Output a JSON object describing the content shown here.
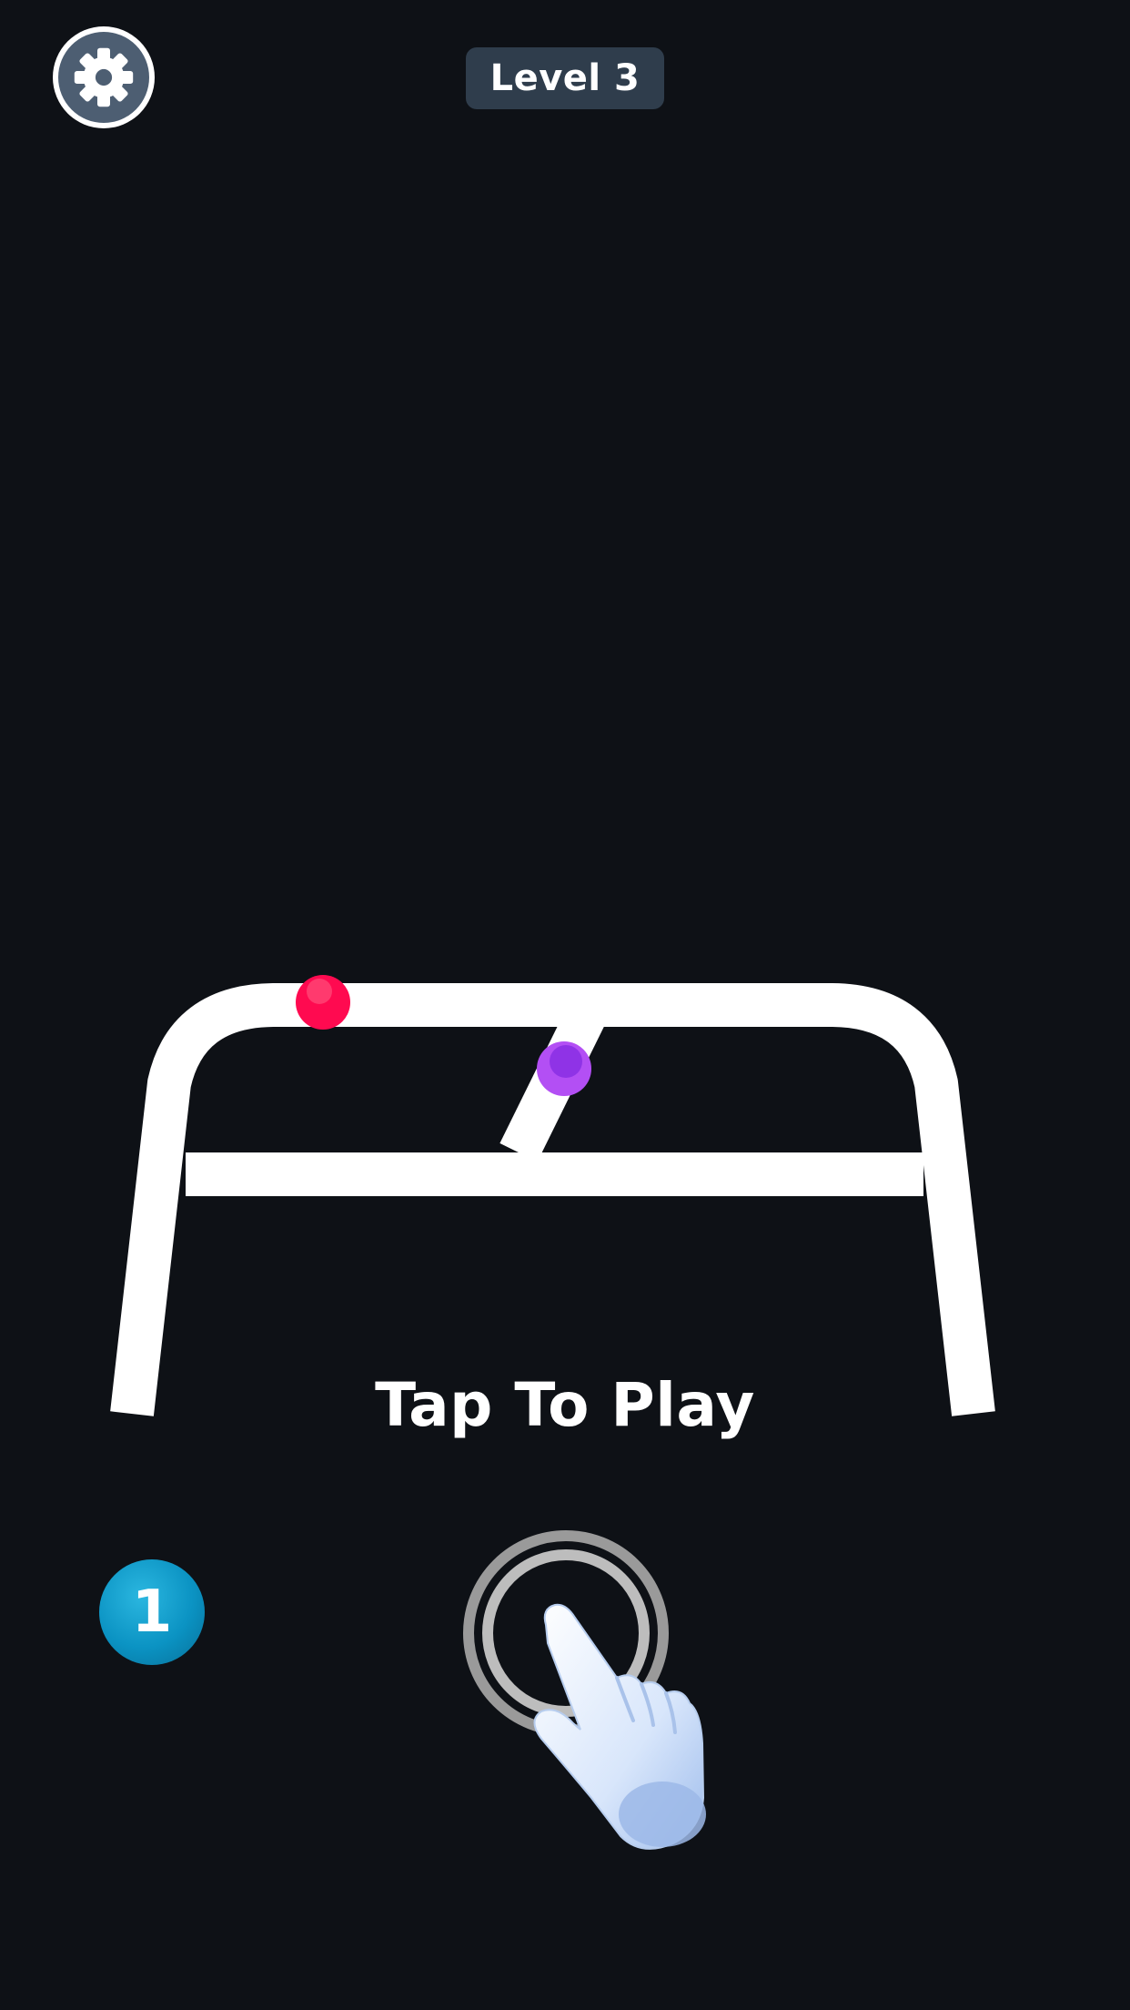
{
  "header": {
    "settings_icon": "gear-icon",
    "level_label": "Level 3"
  },
  "game": {
    "balls": [
      {
        "name": "red-ball",
        "color": "#ff0a50"
      },
      {
        "name": "purple-ball",
        "color": "#a93ff0"
      }
    ],
    "track_color": "#ffffff"
  },
  "prompt": {
    "tap_text": "Tap To Play",
    "hand_icon": "pointing-hand-icon"
  },
  "counter": {
    "value": "1",
    "color": "#0b93c3"
  },
  "colors": {
    "background": "#0e1116",
    "badge": "#2f3d4c",
    "settings_ring": "#4d5e72"
  }
}
